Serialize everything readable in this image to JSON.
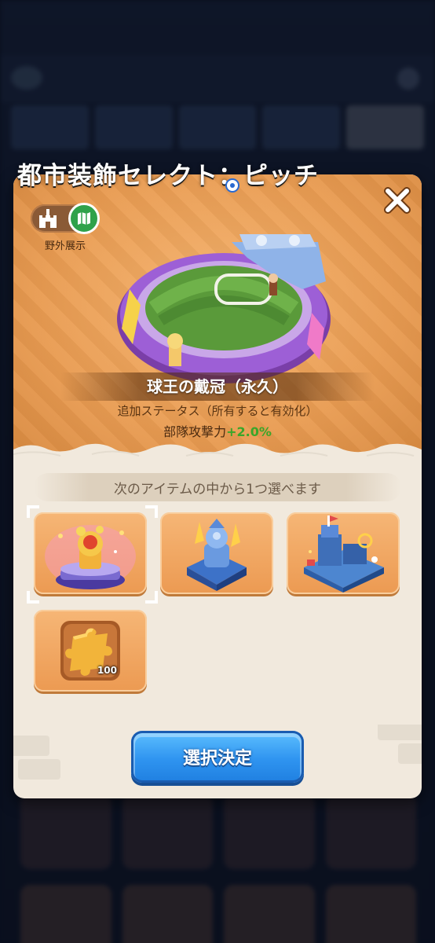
{
  "dialog": {
    "title": "都市装飾セレクト：ピッチ",
    "badge_label": "野外展示",
    "item_name": "球王の戴冠（永久）",
    "status_description": "追加ステータス（所有すると有効化）",
    "status_name": "部隊攻撃力",
    "status_value": "+2.0%",
    "select_hint": "次のアイテムの中から1つ選べます",
    "confirm_label": "選択決定"
  },
  "options": [
    {
      "name": "trophy-fountain",
      "selected": true
    },
    {
      "name": "blue-statue",
      "selected": false
    },
    {
      "name": "blue-castle-stage",
      "selected": false
    },
    {
      "name": "puzzle-piece",
      "quantity": "100",
      "selected": false
    }
  ],
  "icons": {
    "close": "close-icon",
    "badge_left": "castle-icon",
    "badge_right": "map-icon"
  },
  "colors": {
    "banner": "#e99c52",
    "confirm_button": "#2f94f0",
    "status_value": "#3aa62a",
    "option_tile": "#f0a35e"
  }
}
